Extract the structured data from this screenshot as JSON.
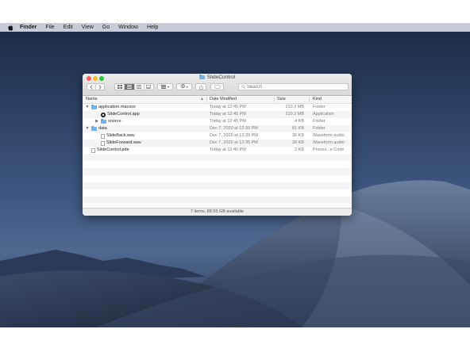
{
  "menubar": {
    "items": [
      {
        "label": "Finder",
        "bold": true
      },
      {
        "label": "File"
      },
      {
        "label": "Edit"
      },
      {
        "label": "View"
      },
      {
        "label": "Go"
      },
      {
        "label": "Window"
      },
      {
        "label": "Help"
      }
    ]
  },
  "window": {
    "title": "SlideControl",
    "search_placeholder": "Search",
    "status": "7 items, 88.55 GB available",
    "columns": {
      "name": "Name",
      "date": "Date Modified",
      "size": "Size",
      "kind": "Kind"
    },
    "rows": [
      {
        "name": "application.macosx",
        "date": "Today at 12:45 PM",
        "size": "210.3 MB",
        "kind": "Folder",
        "icon": "folder-icon",
        "indent": 0,
        "disclosure": "open"
      },
      {
        "name": "SlideControl.app",
        "date": "Today at 12:45 PM",
        "size": "210.3 MB",
        "kind": "Application",
        "icon": "app-icon",
        "indent": 1,
        "disclosure": "none"
      },
      {
        "name": "source",
        "date": "Today at 12:45 PM",
        "size": "4 KB",
        "kind": "Folder",
        "icon": "folder-icon",
        "indent": 1,
        "disclosure": "closed"
      },
      {
        "name": "data",
        "date": "Dec 7, 2020 at 12:39 PM",
        "size": "81 KB",
        "kind": "Folder",
        "icon": "folder-icon",
        "indent": 0,
        "disclosure": "open"
      },
      {
        "name": "SlideBack.wav",
        "date": "Dec 7, 2020 at 12:39 PM",
        "size": "36 KB",
        "kind": "Waveform audio",
        "icon": "document-icon",
        "indent": 1,
        "disclosure": "none"
      },
      {
        "name": "SlideForward.wav",
        "date": "Dec 7, 2020 at 12:35 PM",
        "size": "38 KB",
        "kind": "Waveform audio",
        "icon": "document-icon",
        "indent": 1,
        "disclosure": "none"
      },
      {
        "name": "SlideControl.pde",
        "date": "Today at 12:40 PM",
        "size": "2 KB",
        "kind": "Proces...e Code",
        "icon": "document-icon",
        "indent": 0,
        "disclosure": "none"
      }
    ]
  },
  "colors": {
    "close": "#fc5f57",
    "minimize": "#fdbc2e",
    "zoom": "#28c840",
    "folder": "#6cb4ea"
  }
}
